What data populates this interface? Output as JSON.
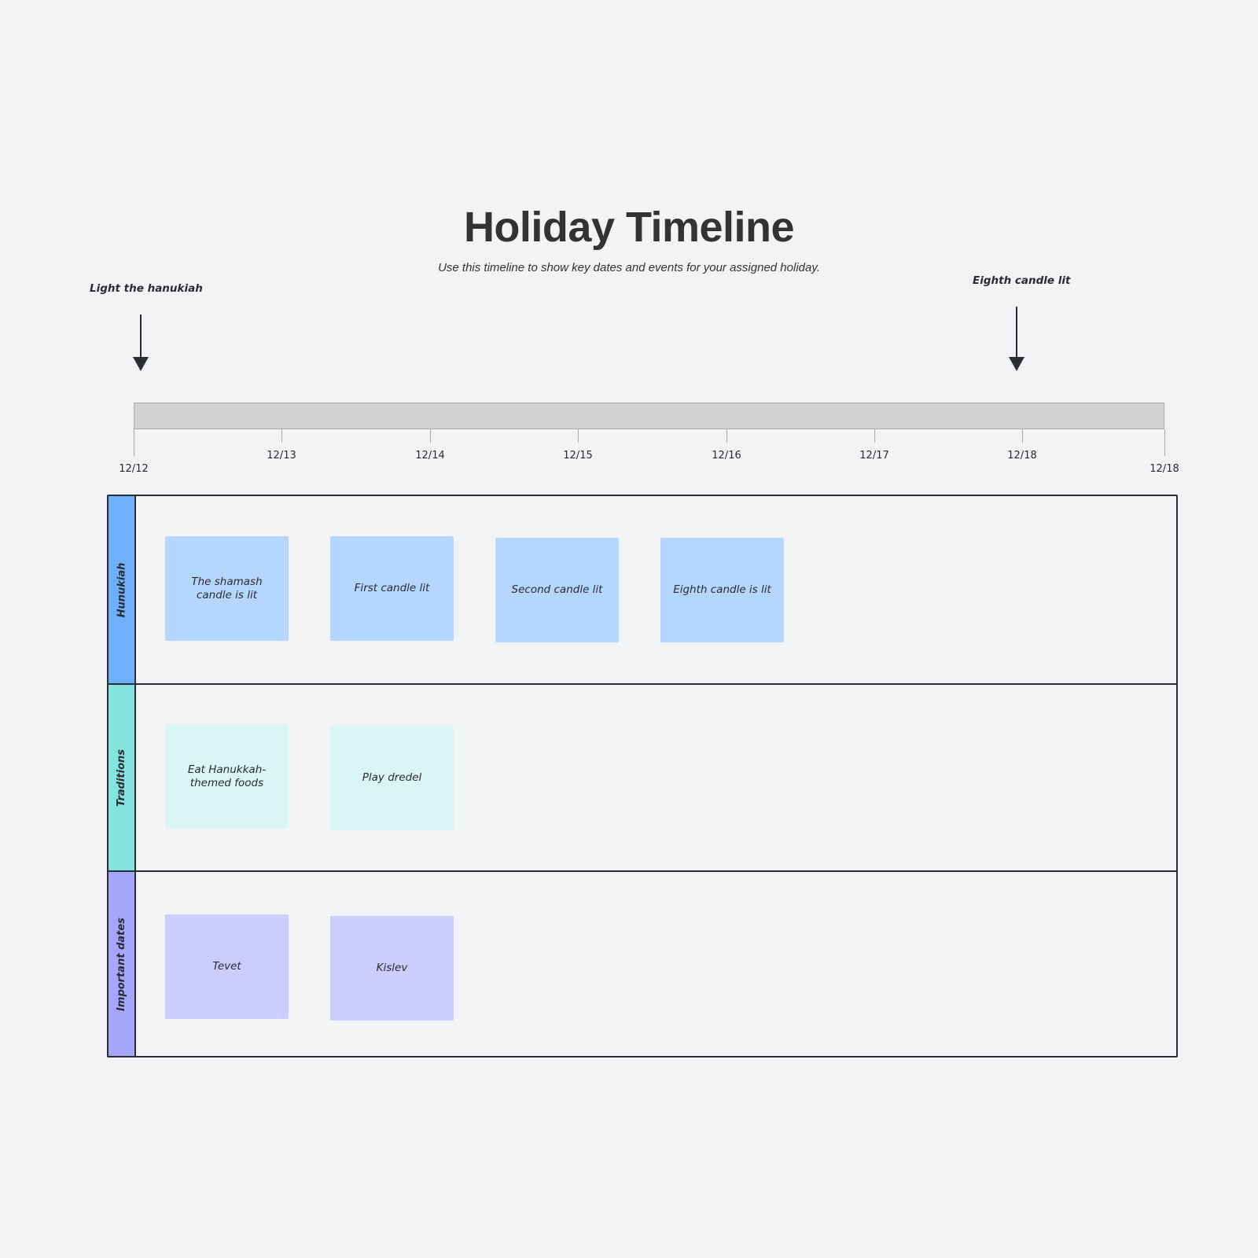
{
  "header": {
    "title": "Holiday Timeline",
    "subtitle": "Use this timeline to show key dates and events  for your assigned  holiday."
  },
  "markers": [
    {
      "label": "Light the hanukiah",
      "date": "12/12",
      "icon": "arrow-down-icon"
    },
    {
      "label": "Eighth candle lit",
      "date": "12/18",
      "icon": "arrow-down-icon"
    }
  ],
  "timeline": {
    "ticks": [
      "12/12",
      "12/13",
      "12/14",
      "12/15",
      "12/16",
      "12/17",
      "12/18",
      "12/18"
    ],
    "bar_color": "#d2d3d5"
  },
  "lanes": [
    {
      "label": "Hunukiah",
      "header_color": "#6eb0fd",
      "card_color": "#b5d6fe",
      "cards": [
        "The shamash candle is lit",
        "First candle lit",
        "Second candle lit",
        "Eighth candle is lit"
      ]
    },
    {
      "label": "Traditions",
      "header_color": "#84e2df",
      "card_color": "#dbf5f5",
      "cards": [
        "Eat Hanukkah-themed foods",
        "Play dredel"
      ]
    },
    {
      "label": "Important dates",
      "header_color": "#a7a6fd",
      "card_color": "#cdcdfd",
      "cards": [
        "Tevet",
        "Kislev"
      ]
    }
  ]
}
